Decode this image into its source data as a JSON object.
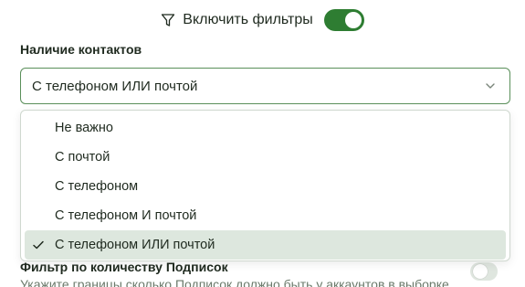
{
  "filters": {
    "icon": "filter-icon",
    "label": "Включить фильтры",
    "enabled": true,
    "accent": "#2e7d32"
  },
  "contacts": {
    "title": "Наличие контактов",
    "selected": "С телефоном ИЛИ почтой",
    "options": [
      "Не важно",
      "С почтой",
      "С телефоном",
      "С телефоном И почтой",
      "С телефоном ИЛИ почтой"
    ],
    "selected_index": 4
  },
  "subscriptions": {
    "title": "Фильтр по количеству Подписок",
    "description": "Укажите границы сколько Подписок должно быть у аккаунтов в выборке",
    "enabled": false
  }
}
